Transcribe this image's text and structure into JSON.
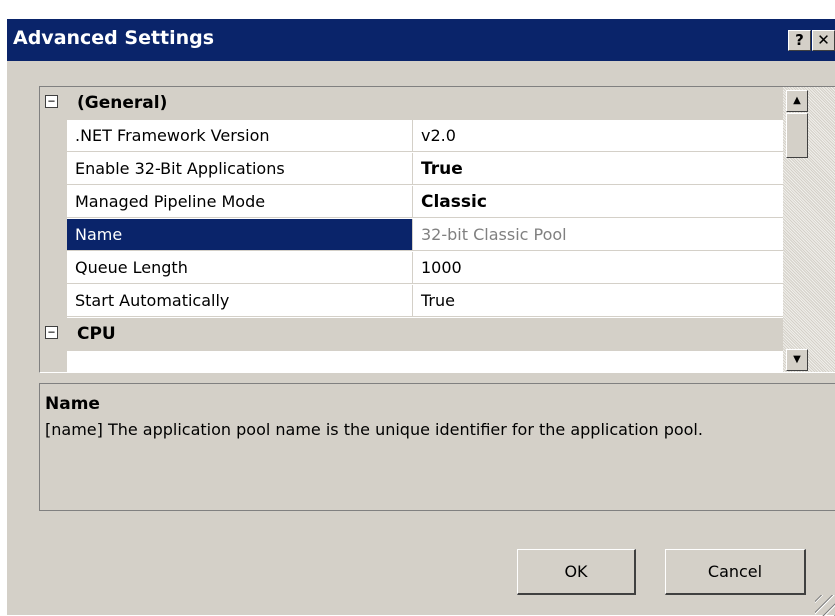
{
  "window": {
    "title": "Advanced Settings",
    "help_label": "?",
    "close_label": "✕"
  },
  "grid": {
    "categories": [
      {
        "toggle": "−",
        "label": "(General)"
      },
      {
        "toggle": "−",
        "label": "CPU"
      }
    ],
    "properties": [
      {
        "name": ".NET Framework Version",
        "value": "v2.0"
      },
      {
        "name": "Enable 32-Bit Applications",
        "value": "True"
      },
      {
        "name": "Managed Pipeline Mode",
        "value": "Classic"
      },
      {
        "name": "Name",
        "value": "32-bit Classic Pool"
      },
      {
        "name": "Queue Length",
        "value": "1000"
      },
      {
        "name": "Start Automatically",
        "value": "True"
      }
    ],
    "scroll_up": "▲",
    "scroll_down": "▼"
  },
  "description": {
    "title": "Name",
    "text": "[name] The application pool name is the unique identifier for the application pool."
  },
  "buttons": {
    "ok": "OK",
    "cancel": "Cancel"
  },
  "colors": {
    "titlebar": "#0a246a",
    "face": "#d4d0c8",
    "selection": "#0a246a"
  }
}
